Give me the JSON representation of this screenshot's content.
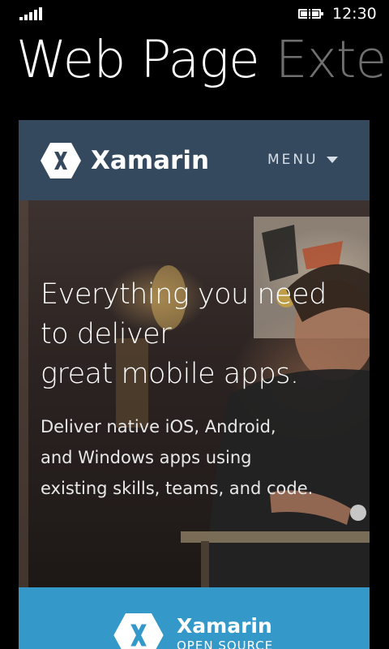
{
  "status_bar": {
    "time": "12:30",
    "signal_icon": "signal-strength-icon",
    "battery_icon": "battery-charging-icon"
  },
  "pivot": {
    "items": [
      {
        "label": "Web Page",
        "active": true
      },
      {
        "label": "Extern",
        "active": false
      }
    ]
  },
  "site": {
    "brand": "Xamarin",
    "logo_icon": "xamarin-hexagon-icon",
    "menu_label": "MENU",
    "menu_icon": "caret-down-icon",
    "header_color": "#34495e",
    "hero": {
      "title_lines": [
        "Everything you need",
        "to deliver",
        "great mobile apps."
      ],
      "subtitle_lines": [
        "Deliver native iOS, Android,",
        "and Windows apps using",
        "existing skills, teams, and code."
      ]
    },
    "open_source": {
      "brand": "Xamarin",
      "sub": "OPEN SOURCE",
      "color": "#3498c9"
    }
  }
}
